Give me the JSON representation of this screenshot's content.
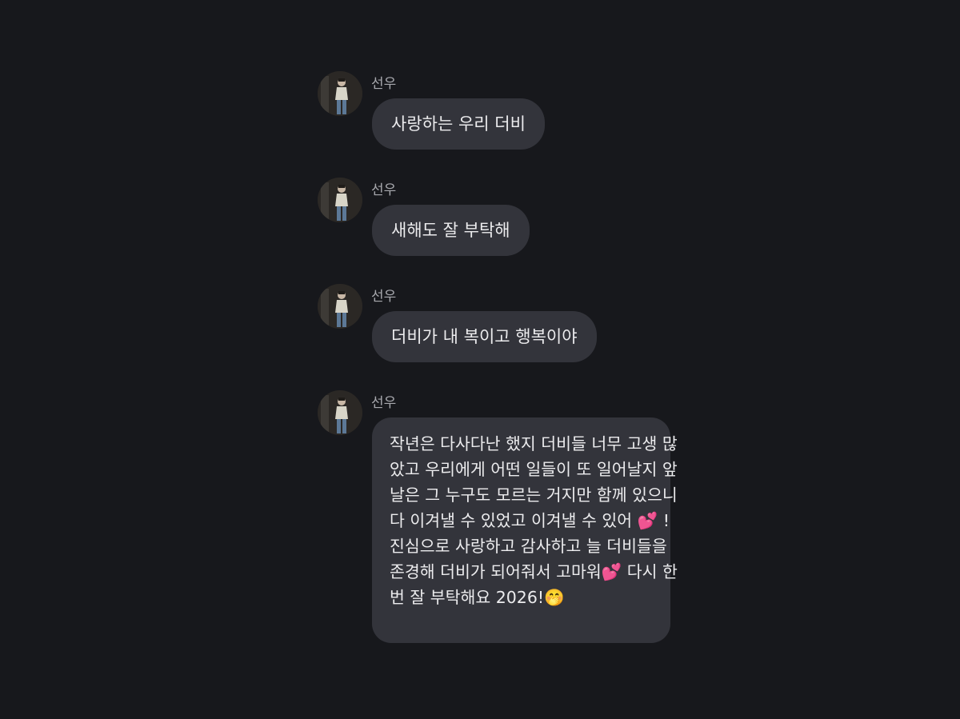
{
  "messages": [
    {
      "sender": "선우",
      "avatar_icon": "profile-photo-icon",
      "text": "사랑하는 우리 더비"
    },
    {
      "sender": "선우",
      "avatar_icon": "profile-photo-icon",
      "text": "새해도 잘 부탁해"
    },
    {
      "sender": "선우",
      "avatar_icon": "profile-photo-icon",
      "text": "더비가 내 복이고 행복이야"
    },
    {
      "sender": "선우",
      "avatar_icon": "profile-photo-icon",
      "lines": [
        "작년은 다사다난 했지 더비들 너무 고생 많",
        "았고 우리에게 어떤 일들이 또 일어날지 앞",
        "날은 그 누구도 모르는 거지만 함께 있으니",
        "다 이겨낼 수 있었고 이겨낼 수 있어 💕 !",
        "진심으로 사랑하고 감사하고 늘 더비들을",
        "존경해 더비가 되어줘서 고마워💕  다시 한",
        "번 잘 부탁해요 2026!🤭"
      ]
    }
  ],
  "colors": {
    "background": "#17181c",
    "bubble": "#33343b",
    "sender_text": "#a8a9ae",
    "message_text": "#ececee"
  }
}
